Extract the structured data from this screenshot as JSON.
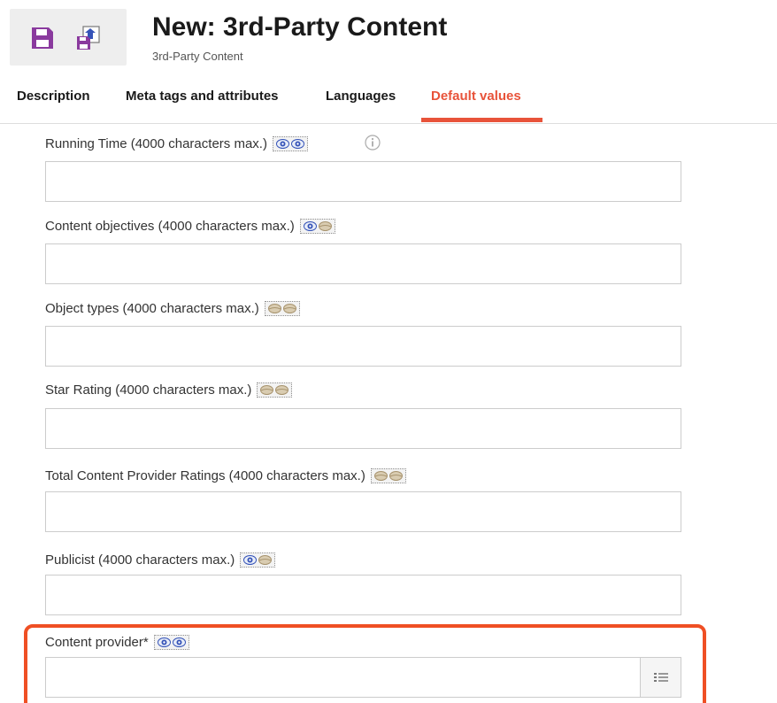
{
  "header": {
    "title": "New: 3rd-Party Content",
    "subtitle": "3rd-Party Content"
  },
  "toolbar": {
    "save_icon": "floppy-disk-icon",
    "save_as_icon": "save-publish-icon"
  },
  "tabs": [
    {
      "label": "Description",
      "active": false
    },
    {
      "label": "Meta tags and attributes",
      "active": false
    },
    {
      "label": "Languages",
      "active": false
    },
    {
      "label": "Default values",
      "active": true
    }
  ],
  "fields": [
    {
      "label": "Running Time (4000 characters max.)",
      "eyes": [
        "visible",
        "visible"
      ],
      "value": ""
    },
    {
      "label": "Content objectives (4000 characters max.)",
      "eyes": [
        "visible",
        "hidden"
      ],
      "value": ""
    },
    {
      "label": "Object types (4000 characters max.)",
      "eyes": [
        "hidden",
        "hidden"
      ],
      "value": ""
    },
    {
      "label": "Star Rating (4000 characters max.)",
      "eyes": [
        "hidden",
        "hidden"
      ],
      "value": ""
    },
    {
      "label": "Total Content Provider Ratings (4000 characters max.)",
      "eyes": [
        "hidden",
        "hidden"
      ],
      "value": ""
    },
    {
      "label": "Publicist (4000 characters max.)",
      "eyes": [
        "visible",
        "hidden"
      ],
      "value": ""
    },
    {
      "label": "Content provider*",
      "eyes": [
        "visible",
        "visible"
      ],
      "value": ""
    }
  ],
  "colors": {
    "accent": "#e8533a",
    "highlight": "#ef4f24",
    "save_icon": "#8a3a9e",
    "eye_visible": "#3553b8",
    "eye_hidden": "#c9b89a"
  }
}
